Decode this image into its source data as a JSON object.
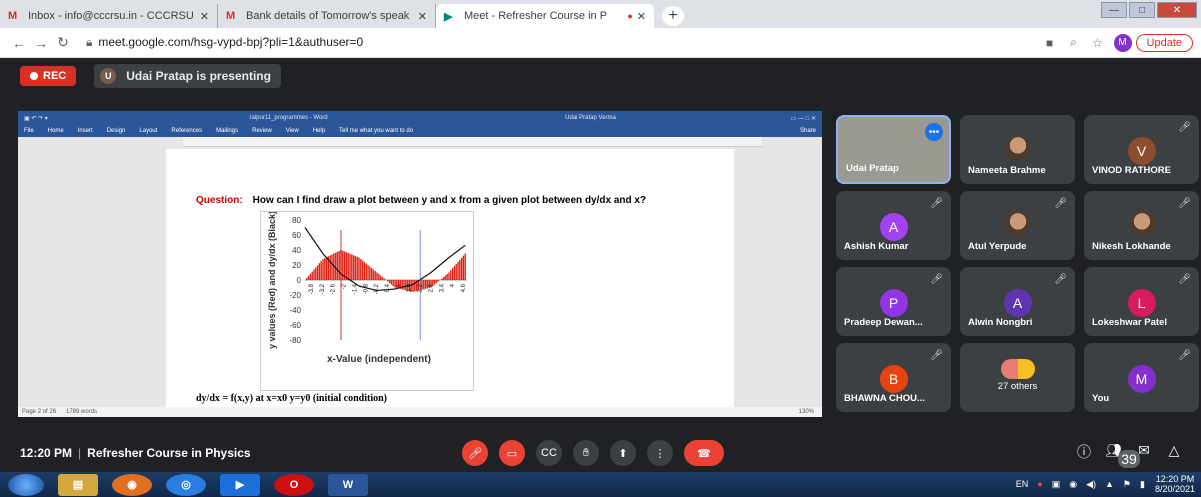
{
  "browser": {
    "tabs": [
      {
        "icon": "M",
        "title": "Inbox - info@cccrsu.in - CCCRSU",
        "active": false
      },
      {
        "icon": "M",
        "title": "Bank details of Tomorrow's speak",
        "active": false
      },
      {
        "icon": "▶",
        "title": "Meet - Refresher Course in P",
        "active": true
      }
    ],
    "url": "meet.google.com/hsg-vypd-bpj?pli=1&authuser=0",
    "profile_initial": "M",
    "update_label": "Update"
  },
  "meet": {
    "rec_label": "REC",
    "presenter_initial": "U",
    "presenting_text": "Udai Pratap is presenting",
    "time": "12:20 PM",
    "meeting_title": "Refresher Course in Physics",
    "people_count": "39"
  },
  "word": {
    "title": "raipur11_programmes - Word",
    "user": "Udai Pratap Verma",
    "menu": [
      "File",
      "Home",
      "Insert",
      "Design",
      "Layout",
      "References",
      "Mailings",
      "Review",
      "View",
      "Help",
      "Tell me what you want to do"
    ],
    "share": "Share",
    "question_label": "Question:",
    "question_text": "How can I find draw a plot between y and x from a given plot between dy/dx and x?",
    "formula": "dy/dx = f(x,y)       at x=x0  y=y0  (initial condition)",
    "status_page": "Page 2 of 26",
    "status_words": "1789 words",
    "zoom": "130%"
  },
  "chart_data": {
    "type": "line",
    "ylabel": "y values (Red) and dy/dx (Black)",
    "xlabel": "x-Value (independent)",
    "ylim": [
      -80,
      80
    ],
    "yticks": [
      80,
      60,
      40,
      20,
      0,
      -20,
      -40,
      -60,
      -80
    ],
    "xticks": [
      "-3.8",
      "-3.2",
      "-2.6",
      "-2",
      "-1.4",
      "-0.8",
      "-0.2",
      "0.4",
      "1",
      "1.6",
      "2.2",
      "2.8",
      "3.4",
      "4",
      "4.6"
    ],
    "series": [
      {
        "x": [
          -4,
          -3,
          -2,
          -1,
          0,
          1,
          2,
          3,
          4,
          5
        ],
        "values": [
          0,
          28,
          40,
          30,
          10,
          -10,
          -16,
          -10,
          10,
          38
        ]
      },
      {
        "x": [
          -4,
          -3,
          -2,
          -1,
          0,
          1,
          2,
          3,
          4,
          5
        ],
        "values": [
          70,
          35,
          8,
          -8,
          -14,
          -12,
          -6,
          10,
          30,
          48
        ]
      }
    ]
  },
  "participants": [
    {
      "name": "Udai Pratap",
      "initial": "",
      "color": "",
      "muted": false,
      "type": "presenter"
    },
    {
      "name": "Nameeta Brahme",
      "initial": "",
      "color": "",
      "muted": false,
      "type": "photo"
    },
    {
      "name": "VINOD RATHORE",
      "initial": "V",
      "color": "#8d4e2f",
      "muted": true,
      "type": "initial"
    },
    {
      "name": "Ashish Kumar",
      "initial": "A",
      "color": "#a142f4",
      "muted": true,
      "type": "initial"
    },
    {
      "name": "Atul Yerpude",
      "initial": "",
      "color": "",
      "muted": true,
      "type": "photo"
    },
    {
      "name": "Nikesh Lokhande",
      "initial": "",
      "color": "",
      "muted": true,
      "type": "photo"
    },
    {
      "name": "Pradeep Dewan...",
      "initial": "P",
      "color": "#9334e6",
      "muted": true,
      "type": "initial"
    },
    {
      "name": "Alwin Nongbri",
      "initial": "A",
      "color": "#5e35b1",
      "muted": true,
      "type": "initial"
    },
    {
      "name": "Lokeshwar Patel",
      "initial": "L",
      "color": "#d81b60",
      "muted": true,
      "type": "initial"
    },
    {
      "name": "BHAWNA CHOU...",
      "initial": "B",
      "color": "#e8430f",
      "muted": true,
      "type": "initial"
    },
    {
      "name": "27 others",
      "initial": "",
      "color": "",
      "muted": false,
      "type": "others"
    },
    {
      "name": "You",
      "initial": "M",
      "color": "#8430ce",
      "muted": true,
      "type": "initial"
    }
  ],
  "taskbar": {
    "lang": "EN",
    "time": "12:20 PM",
    "date": "8/20/2021"
  }
}
